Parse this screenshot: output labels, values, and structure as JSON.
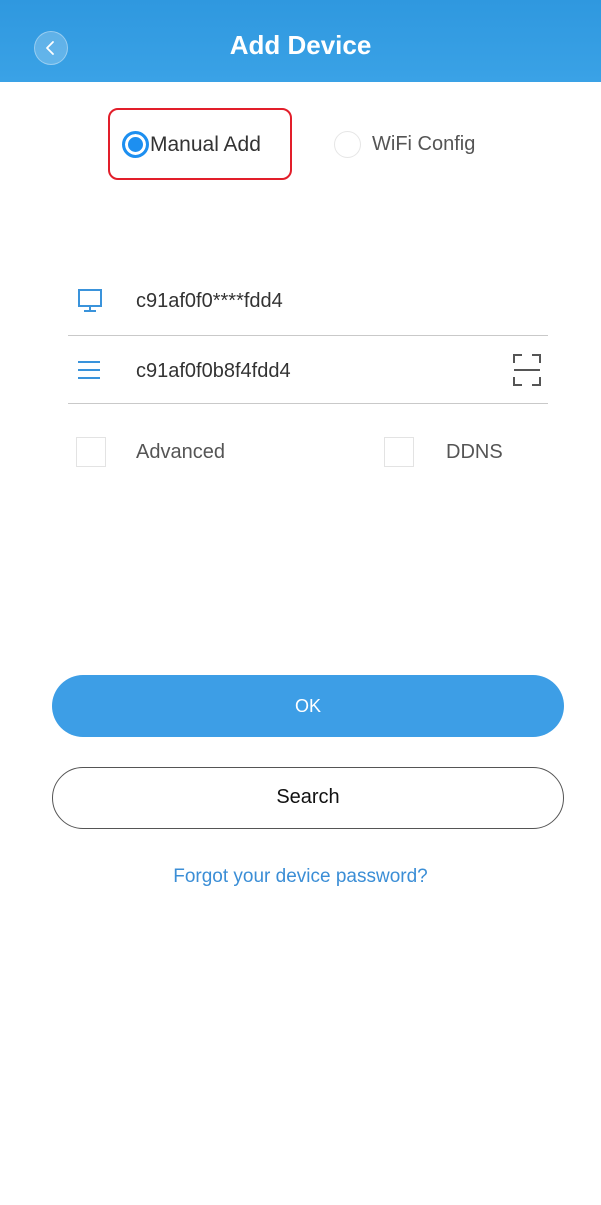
{
  "header": {
    "title": "Add Device",
    "back_icon": "back-chevron-icon",
    "color": "#3aa2e6"
  },
  "mode": {
    "selected": "Manual Add",
    "options": [
      {
        "label": "Manual Add",
        "selected": true
      },
      {
        "label": "WiFi Config",
        "selected": false
      }
    ],
    "highlight_color": "#e21e2a"
  },
  "fields": {
    "device_id": {
      "value": "c91af0f0****fdd4",
      "icon": "monitor-icon"
    },
    "serial": {
      "value": "c91af0f0b8f4fdd4",
      "icon": "list-icon",
      "scan_icon": "scan-frame-icon"
    }
  },
  "options": {
    "advanced": {
      "label": "Advanced",
      "checked": false
    },
    "ddns": {
      "label": "DDNS",
      "checked": false
    }
  },
  "buttons": {
    "ok": "OK",
    "search": "Search"
  },
  "links": {
    "forgot_password": "Forgot your device password?"
  },
  "colors": {
    "accent": "#3d9ee6",
    "radio_on": "#1d8ff0",
    "link": "#3b8ed6"
  }
}
